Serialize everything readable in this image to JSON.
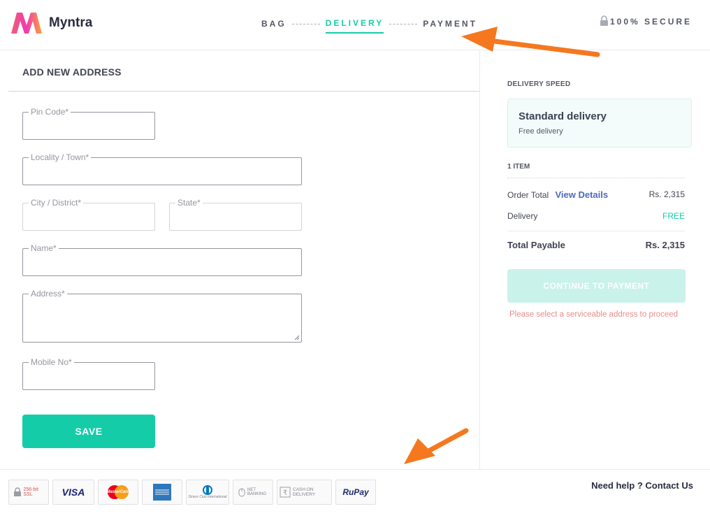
{
  "header": {
    "brand": "Myntra",
    "steps": [
      "BAG",
      "DELIVERY",
      "PAYMENT"
    ],
    "active_step": "DELIVERY",
    "secure_label": "100% SECURE"
  },
  "address_form": {
    "title": "ADD NEW ADDRESS",
    "fields": {
      "pincode": {
        "label": "Pin Code*",
        "value": ""
      },
      "locality": {
        "label": "Locality / Town*",
        "value": ""
      },
      "city": {
        "label": "City / District*",
        "value": ""
      },
      "state": {
        "label": "State*",
        "value": ""
      },
      "name": {
        "label": "Name*",
        "value": ""
      },
      "address": {
        "label": "Address*",
        "value": ""
      },
      "mobile": {
        "label": "Mobile No*",
        "value": ""
      }
    },
    "save_label": "SAVE"
  },
  "summary": {
    "delivery_speed_title": "DELIVERY SPEED",
    "speed_option": {
      "name": "Standard delivery",
      "note": "Free delivery"
    },
    "items_count": "1 ITEM",
    "order_total_label": "Order Total",
    "view_details_label": "View Details",
    "order_total_value": "Rs. 2,315",
    "delivery_label": "Delivery",
    "delivery_value": "FREE",
    "total_payable_label": "Total Payable",
    "total_payable_value": "Rs. 2,315",
    "continue_label": "CONTINUE TO PAYMENT",
    "error_message": "Please select a serviceable address to proceed"
  },
  "footer": {
    "badges": [
      {
        "name": "ssl-badge",
        "text": "256-bit SSL"
      },
      {
        "name": "visa-badge",
        "text": "VISA"
      },
      {
        "name": "mastercard-badge",
        "text": "MasterCard"
      },
      {
        "name": "amex-badge",
        "text": ""
      },
      {
        "name": "diners-club-badge",
        "text": "Diners Club International"
      },
      {
        "name": "net-banking-badge",
        "text": "NET BANKING"
      },
      {
        "name": "cash-on-delivery-badge",
        "text": "CASH ON DELIVERY"
      },
      {
        "name": "rupay-badge",
        "text": "RuPay"
      }
    ],
    "help_text": "Need help ? Contact Us"
  },
  "colors": {
    "accent": "#14cda8",
    "link": "#4e6ab8",
    "error": "#e88c8c",
    "annotation_arrow": "#f5781e"
  }
}
